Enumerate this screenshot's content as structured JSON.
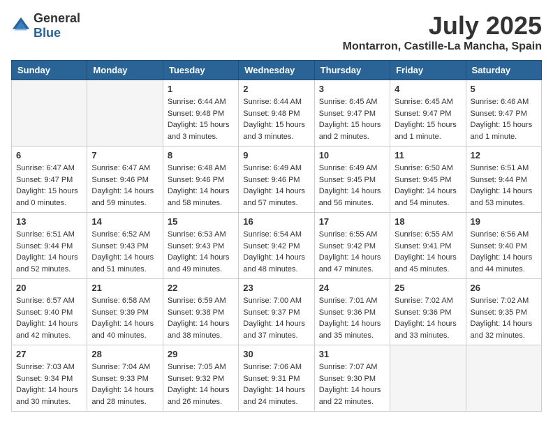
{
  "header": {
    "logo_general": "General",
    "logo_blue": "Blue",
    "month_title": "July 2025",
    "location": "Montarron, Castille-La Mancha, Spain"
  },
  "days_of_week": [
    "Sunday",
    "Monday",
    "Tuesday",
    "Wednesday",
    "Thursday",
    "Friday",
    "Saturday"
  ],
  "weeks": [
    [
      {
        "day": "",
        "info": ""
      },
      {
        "day": "",
        "info": ""
      },
      {
        "day": "1",
        "info": "Sunrise: 6:44 AM\nSunset: 9:48 PM\nDaylight: 15 hours and 3 minutes."
      },
      {
        "day": "2",
        "info": "Sunrise: 6:44 AM\nSunset: 9:48 PM\nDaylight: 15 hours and 3 minutes."
      },
      {
        "day": "3",
        "info": "Sunrise: 6:45 AM\nSunset: 9:47 PM\nDaylight: 15 hours and 2 minutes."
      },
      {
        "day": "4",
        "info": "Sunrise: 6:45 AM\nSunset: 9:47 PM\nDaylight: 15 hours and 1 minute."
      },
      {
        "day": "5",
        "info": "Sunrise: 6:46 AM\nSunset: 9:47 PM\nDaylight: 15 hours and 1 minute."
      }
    ],
    [
      {
        "day": "6",
        "info": "Sunrise: 6:47 AM\nSunset: 9:47 PM\nDaylight: 15 hours and 0 minutes."
      },
      {
        "day": "7",
        "info": "Sunrise: 6:47 AM\nSunset: 9:46 PM\nDaylight: 14 hours and 59 minutes."
      },
      {
        "day": "8",
        "info": "Sunrise: 6:48 AM\nSunset: 9:46 PM\nDaylight: 14 hours and 58 minutes."
      },
      {
        "day": "9",
        "info": "Sunrise: 6:49 AM\nSunset: 9:46 PM\nDaylight: 14 hours and 57 minutes."
      },
      {
        "day": "10",
        "info": "Sunrise: 6:49 AM\nSunset: 9:45 PM\nDaylight: 14 hours and 56 minutes."
      },
      {
        "day": "11",
        "info": "Sunrise: 6:50 AM\nSunset: 9:45 PM\nDaylight: 14 hours and 54 minutes."
      },
      {
        "day": "12",
        "info": "Sunrise: 6:51 AM\nSunset: 9:44 PM\nDaylight: 14 hours and 53 minutes."
      }
    ],
    [
      {
        "day": "13",
        "info": "Sunrise: 6:51 AM\nSunset: 9:44 PM\nDaylight: 14 hours and 52 minutes."
      },
      {
        "day": "14",
        "info": "Sunrise: 6:52 AM\nSunset: 9:43 PM\nDaylight: 14 hours and 51 minutes."
      },
      {
        "day": "15",
        "info": "Sunrise: 6:53 AM\nSunset: 9:43 PM\nDaylight: 14 hours and 49 minutes."
      },
      {
        "day": "16",
        "info": "Sunrise: 6:54 AM\nSunset: 9:42 PM\nDaylight: 14 hours and 48 minutes."
      },
      {
        "day": "17",
        "info": "Sunrise: 6:55 AM\nSunset: 9:42 PM\nDaylight: 14 hours and 47 minutes."
      },
      {
        "day": "18",
        "info": "Sunrise: 6:55 AM\nSunset: 9:41 PM\nDaylight: 14 hours and 45 minutes."
      },
      {
        "day": "19",
        "info": "Sunrise: 6:56 AM\nSunset: 9:40 PM\nDaylight: 14 hours and 44 minutes."
      }
    ],
    [
      {
        "day": "20",
        "info": "Sunrise: 6:57 AM\nSunset: 9:40 PM\nDaylight: 14 hours and 42 minutes."
      },
      {
        "day": "21",
        "info": "Sunrise: 6:58 AM\nSunset: 9:39 PM\nDaylight: 14 hours and 40 minutes."
      },
      {
        "day": "22",
        "info": "Sunrise: 6:59 AM\nSunset: 9:38 PM\nDaylight: 14 hours and 38 minutes."
      },
      {
        "day": "23",
        "info": "Sunrise: 7:00 AM\nSunset: 9:37 PM\nDaylight: 14 hours and 37 minutes."
      },
      {
        "day": "24",
        "info": "Sunrise: 7:01 AM\nSunset: 9:36 PM\nDaylight: 14 hours and 35 minutes."
      },
      {
        "day": "25",
        "info": "Sunrise: 7:02 AM\nSunset: 9:36 PM\nDaylight: 14 hours and 33 minutes."
      },
      {
        "day": "26",
        "info": "Sunrise: 7:02 AM\nSunset: 9:35 PM\nDaylight: 14 hours and 32 minutes."
      }
    ],
    [
      {
        "day": "27",
        "info": "Sunrise: 7:03 AM\nSunset: 9:34 PM\nDaylight: 14 hours and 30 minutes."
      },
      {
        "day": "28",
        "info": "Sunrise: 7:04 AM\nSunset: 9:33 PM\nDaylight: 14 hours and 28 minutes."
      },
      {
        "day": "29",
        "info": "Sunrise: 7:05 AM\nSunset: 9:32 PM\nDaylight: 14 hours and 26 minutes."
      },
      {
        "day": "30",
        "info": "Sunrise: 7:06 AM\nSunset: 9:31 PM\nDaylight: 14 hours and 24 minutes."
      },
      {
        "day": "31",
        "info": "Sunrise: 7:07 AM\nSunset: 9:30 PM\nDaylight: 14 hours and 22 minutes."
      },
      {
        "day": "",
        "info": ""
      },
      {
        "day": "",
        "info": ""
      }
    ]
  ]
}
